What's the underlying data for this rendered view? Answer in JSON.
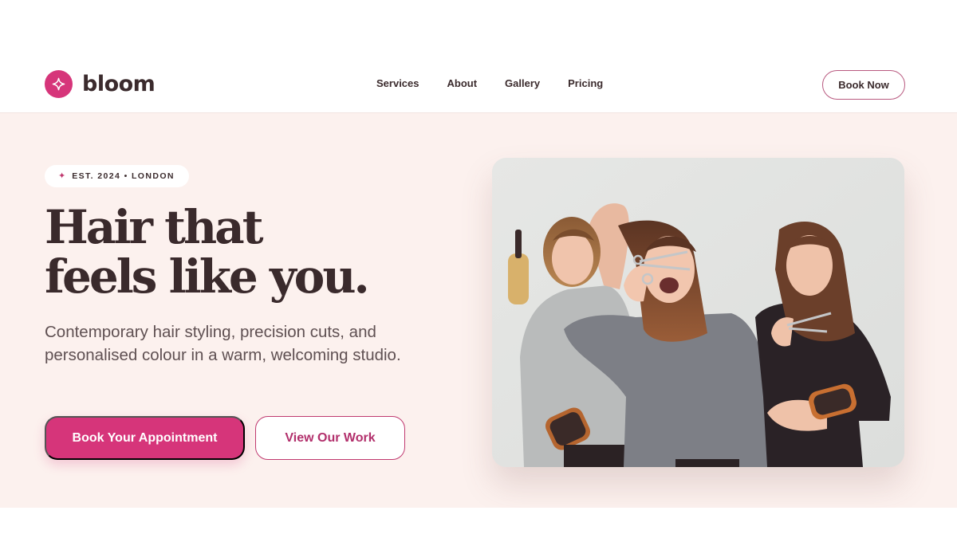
{
  "brand": {
    "name": "bloom",
    "logo_icon": "sparkle-icon",
    "accent": "#d6357a"
  },
  "nav": {
    "links": [
      "Services",
      "About",
      "Gallery",
      "Pricing"
    ],
    "cta_label": "Book Now"
  },
  "hero": {
    "badge_icon": "sparkle-icon",
    "badge_text": "EST. 2024 • LONDON",
    "headline_lines": [
      "Hair that",
      "feels like you."
    ],
    "subtext": "Contemporary hair styling, precision cuts, and personalised colour in a warm, welcoming studio.",
    "primary_cta": "Book Your Appointment",
    "secondary_cta": "View Our Work",
    "image_subject": "three smiling hairstylists holding brushes and scissors"
  },
  "colors": {
    "hero_background": "#fcf1ee",
    "text_dark": "#3a2a2c",
    "accent_pink": "#d6357a"
  }
}
